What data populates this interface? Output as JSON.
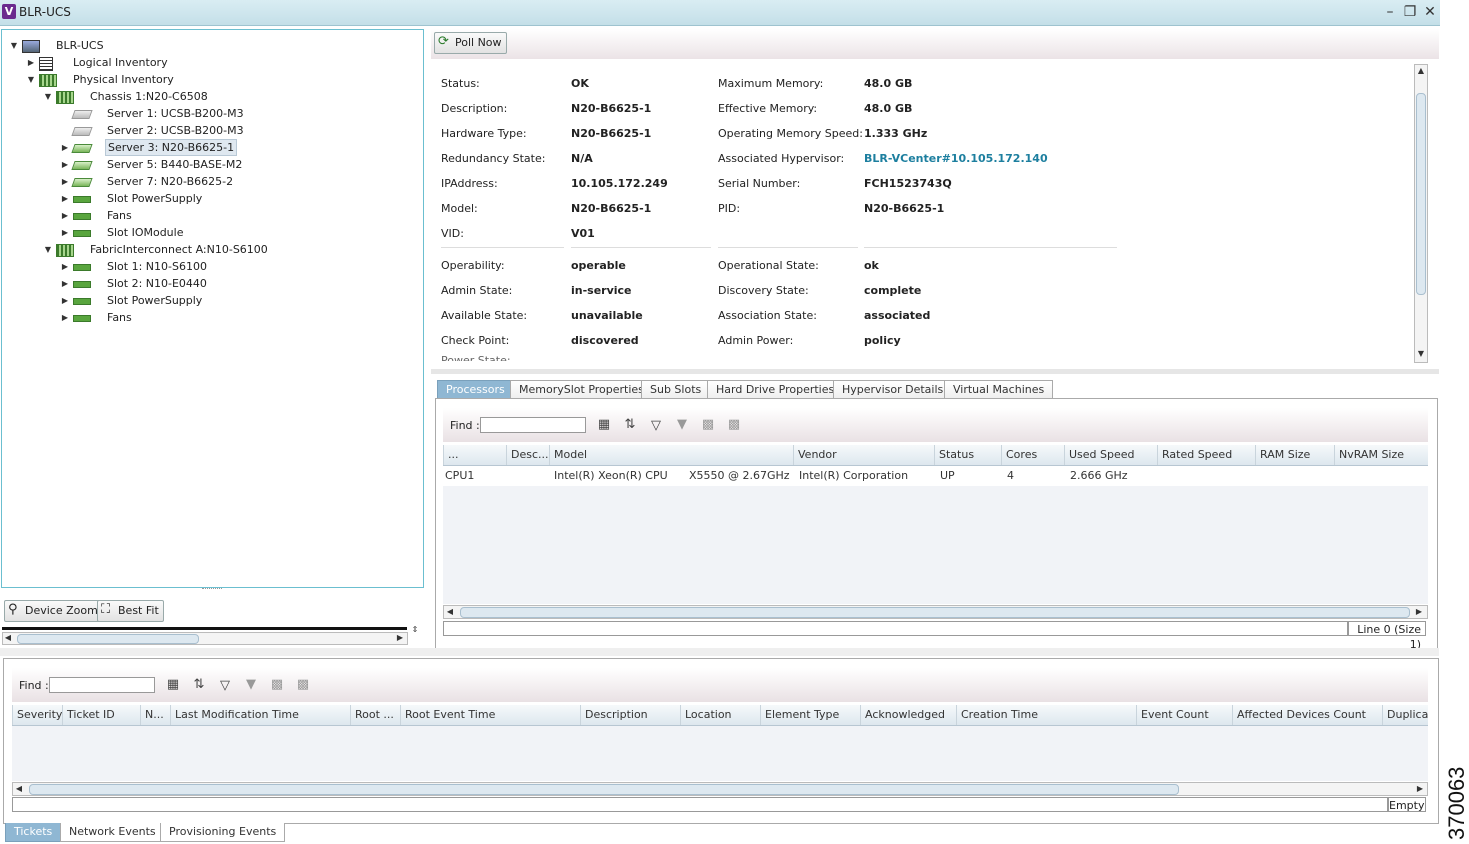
{
  "window": {
    "title": "BLR-UCS",
    "icon_letter": "V"
  },
  "tree": {
    "items": [
      {
        "label": "BLR-UCS",
        "icon": "topology-icon",
        "expander": "expanded"
      },
      {
        "label": "Logical Inventory",
        "icon": "document-icon",
        "expander": "collapsed"
      },
      {
        "label": "Physical Inventory",
        "icon": "chassis-icon",
        "expander": "expanded"
      },
      {
        "label": "Chassis 1:N20-C6508",
        "icon": "chassis-icon",
        "expander": "expanded"
      },
      {
        "label": "Server 1: UCSB-B200-M3",
        "icon": "server-icon",
        "expander": "none"
      },
      {
        "label": "Server 2: UCSB-B200-M3",
        "icon": "server-icon",
        "expander": "none"
      },
      {
        "label": "Server 3: N20-B6625-1",
        "icon": "server-icon",
        "expander": "collapsed",
        "selected": true
      },
      {
        "label": "Server 5: B440-BASE-M2",
        "icon": "server-icon",
        "expander": "collapsed"
      },
      {
        "label": "Server 7: N20-B6625-2",
        "icon": "server-icon",
        "expander": "collapsed"
      },
      {
        "label": "Slot PowerSupply",
        "icon": "slot-icon",
        "expander": "collapsed"
      },
      {
        "label": "Fans",
        "icon": "slot-icon",
        "expander": "collapsed"
      },
      {
        "label": "Slot IOModule",
        "icon": "slot-icon",
        "expander": "collapsed"
      },
      {
        "label": "FabricInterconnect A:N10-S6100",
        "icon": "chassis-icon",
        "expander": "expanded"
      },
      {
        "label": "Slot 1: N10-S6100",
        "icon": "slot-icon",
        "expander": "collapsed"
      },
      {
        "label": "Slot 2: N10-E0440",
        "icon": "slot-icon",
        "expander": "collapsed"
      },
      {
        "label": "Slot PowerSupply",
        "icon": "slot-icon",
        "expander": "collapsed"
      },
      {
        "label": "Fans",
        "icon": "slot-icon",
        "expander": "collapsed"
      }
    ],
    "device_zoom_label": "Device Zoom",
    "best_fit_label": "Best Fit"
  },
  "detail": {
    "poll_now_label": "Poll Now",
    "left_fields": [
      {
        "label": "Status:",
        "value": "OK"
      },
      {
        "label": "Description:",
        "value": "N20-B6625-1"
      },
      {
        "label": "Hardware Type:",
        "value": "N20-B6625-1"
      },
      {
        "label": "Redundancy State:",
        "value": "N/A"
      },
      {
        "label": "IPAddress:",
        "value": "10.105.172.249"
      },
      {
        "label": "Model:",
        "value": "N20-B6625-1"
      },
      {
        "label": "VID:",
        "value": "V01"
      }
    ],
    "right_fields": [
      {
        "label": "Maximum Memory:",
        "value": "48.0 GB"
      },
      {
        "label": "Effective Memory:",
        "value": "48.0 GB"
      },
      {
        "label": "Operating Memory Speed:",
        "value": "1.333 GHz"
      },
      {
        "label": "Associated Hypervisor:",
        "value": "BLR-VCenter#10.105.172.140"
      },
      {
        "label": "Serial Number:",
        "value": "FCH1523743Q"
      },
      {
        "label": "PID:",
        "value": "N20-B6625-1"
      }
    ],
    "left_state": [
      {
        "label": "Operability:",
        "value": "operable"
      },
      {
        "label": "Admin State:",
        "value": "in-service"
      },
      {
        "label": "Available State:",
        "value": "unavailable"
      },
      {
        "label": "Check Point:",
        "value": "discovered"
      }
    ],
    "right_state": [
      {
        "label": "Operational State:",
        "value": "ok"
      },
      {
        "label": "Discovery State:",
        "value": "complete"
      },
      {
        "label": "Association State:",
        "value": "associated"
      },
      {
        "label": "Admin Power:",
        "value": "policy"
      }
    ],
    "truncated_label": "Power State:"
  },
  "proc_tabs": [
    "Processors",
    "MemorySlot Properties",
    "Sub Slots",
    "Hard Drive Properties",
    "Hypervisor Details",
    "Virtual Machines"
  ],
  "proc_table": {
    "find_label": "Find :",
    "columns": [
      "...",
      "Desc...",
      "Model",
      "Vendor",
      "Status",
      "Cores",
      "Used Speed",
      "Rated Speed",
      "RAM Size",
      "NvRAM Size"
    ],
    "rows": [
      {
        "name": "CPU1",
        "desc": "",
        "model": "Intel(R) Xeon(R) CPU",
        "model2": "X5550  @ 2.67GHz",
        "vendor": "Intel(R) Corporation",
        "status": "UP",
        "cores": "4",
        "used_speed": "2.666 GHz",
        "rated_speed": "",
        "ram": "",
        "nvram": ""
      }
    ],
    "status_text": "Line 0 (Size 1)"
  },
  "tickets_table": {
    "find_label": "Find :",
    "columns": [
      "Severity",
      "Ticket ID",
      "N...",
      "Last Modification Time",
      "Root ...",
      "Root Event Time",
      "Description",
      "Location",
      "Element Type",
      "Acknowledged",
      "Creation Time",
      "Event Count",
      "Affected Devices Count",
      "Duplicati"
    ],
    "status_text": "Empty"
  },
  "bottom_tabs": [
    "Tickets",
    "Network Events",
    "Provisioning Events"
  ],
  "figure_number": "370063",
  "colors": {
    "accent": "#8fb7d3",
    "link": "#1d7f9f",
    "border": "#6bbfd0"
  }
}
